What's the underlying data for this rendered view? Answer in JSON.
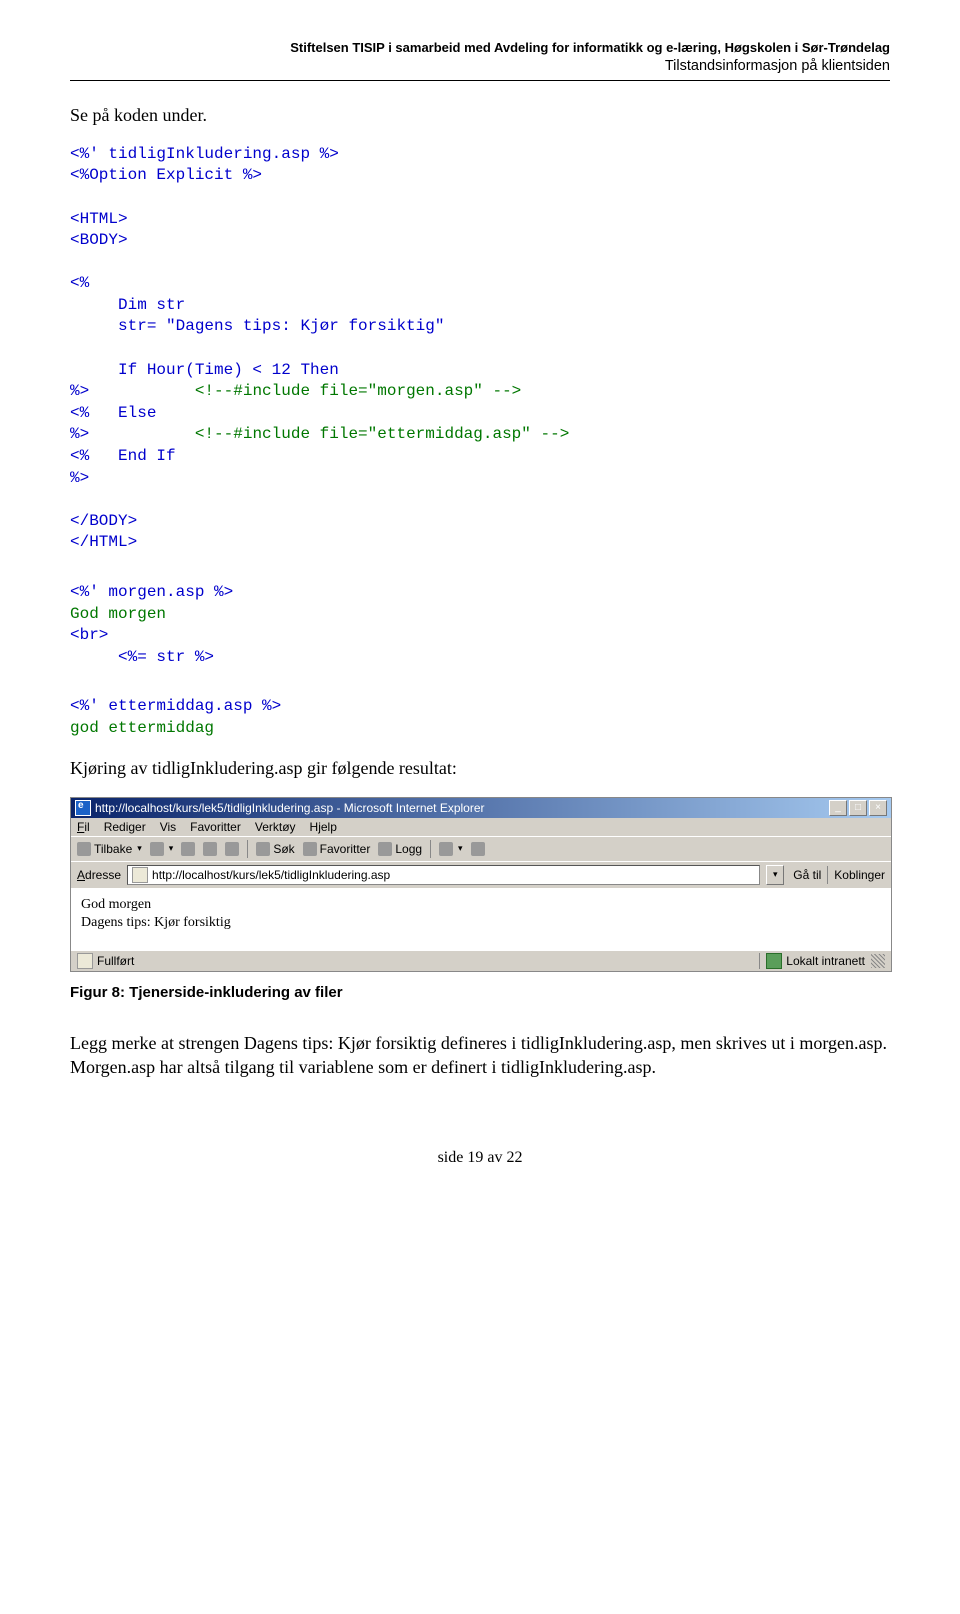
{
  "header": {
    "line1": "Stiftelsen TISIP i samarbeid med Avdeling for informatikk og e-læring, Høgskolen i Sør-Trøndelag",
    "line2": "Tilstandsinformasjon på klientsiden"
  },
  "intro": "Se på koden under.",
  "code": {
    "t1": "<%' tidligInkludering.asp %>",
    "t2": "<%Option Explicit %>",
    "t3": "<HTML>",
    "t4": "<BODY>",
    "t5": "<%",
    "t6": "     Dim str",
    "t7": "     str= \"Dagens tips: Kjør forsiktig\"",
    "t8": "     If Hour(Time) < 12 Then",
    "t9": "%>           ",
    "t9b": "<!--#include file=\"morgen.asp\" -->",
    "t10": "<%   Else",
    "t11": "%>           ",
    "t11b": "<!--#include file=\"ettermiddag.asp\" -->",
    "t12": "<%   End If",
    "t13": "%>",
    "t14": "</BODY>",
    "t15": "</HTML>",
    "m1": "<%' morgen.asp %>",
    "m2": "God morgen",
    "m3": "<br>",
    "m4": "     <%= str %>",
    "e1": "<%' ettermiddag.asp %>",
    "e2": "god ettermiddag"
  },
  "resultIntro": "Kjøring av tidligInkludering.asp gir følgende resultat:",
  "browser": {
    "title": "http://localhost/kurs/lek5/tidligInkludering.asp - Microsoft Internet Explorer",
    "menu": {
      "fil": "Fil",
      "rediger": "Rediger",
      "vis": "Vis",
      "favoritter": "Favoritter",
      "verktoy": "Verktøy",
      "hjelp": "Hjelp"
    },
    "toolbar": {
      "tilbake": "Tilbake",
      "sok": "Søk",
      "favoritter": "Favoritter",
      "logg": "Logg"
    },
    "addressLabel": "Adresse",
    "url": "http://localhost/kurs/lek5/tidligInkludering.asp",
    "go": "Gå til",
    "koblinger": "Koblinger",
    "content": {
      "line1": "God morgen",
      "line2": "Dagens tips: Kjør forsiktig"
    },
    "status": "Fullført",
    "zone": "Lokalt intranett",
    "winbtns": {
      "min": "_",
      "max": "□",
      "close": "×"
    }
  },
  "figcap": "Figur 8: Tjenerside-inkludering av filer",
  "para1": "Legg merke at strengen Dagens tips: Kjør forsiktig defineres i tidligInkludering.asp, men skrives ut i morgen.asp. Morgen.asp har altså tilgang til variablene som er definert i tidligInkludering.asp.",
  "footer": "side 19 av 22"
}
